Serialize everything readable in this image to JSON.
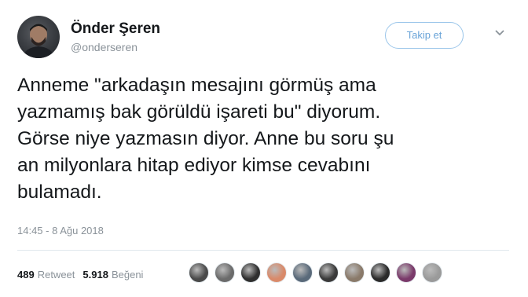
{
  "tweet": {
    "author": {
      "display_name": "Önder Şeren",
      "handle": "@onderseren"
    },
    "follow_label": "Takip et",
    "text": "Anneme \"arkadaşın mesajını görmüş ama\nyazmamış bak görüldü işareti bu\" diyorum.\nGörse niye yazmasın diyor. Anne bu soru şu\nan milyonlara hitap ediyor kimse cevabını\nbulamadı.",
    "timestamp": "14:45 - 8 Ağu 2018",
    "retweets": {
      "count": "489",
      "label": "Retweet"
    },
    "likes": {
      "count": "5.918",
      "label": "Beğeni"
    },
    "liker_avatar_colors": [
      "#4a4a4a",
      "#6b6b6b",
      "#2f2f2f",
      "#d98a6a",
      "#5a6a7a",
      "#3a3a3a",
      "#8a7a6a",
      "#2a2a2a",
      "#7a3a6a",
      "#9a9a9a"
    ]
  },
  "icons": {
    "caret": "chevron-down-icon"
  }
}
